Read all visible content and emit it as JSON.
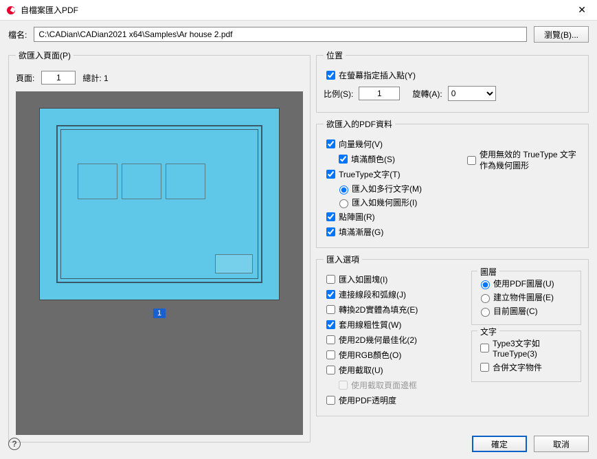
{
  "titlebar": {
    "title": "自檔案匯入PDF"
  },
  "file": {
    "label": "檔名:",
    "path": "C:\\CADian\\CADian2021 x64\\Samples\\Ar house 2.pdf",
    "browse": "瀏覽(B)..."
  },
  "pages": {
    "legend": "欲匯入頁面(P)",
    "page_label": "頁面:",
    "page_value": "1",
    "total_label": "總計: 1",
    "page_badge": "1"
  },
  "position": {
    "legend": "位置",
    "specify": "在螢幕指定插入點(Y)",
    "scale_label": "比例(S):",
    "scale_value": "1",
    "rotate_label": "旋轉(A):",
    "rotate_value": "0"
  },
  "pdfdata": {
    "legend": "欲匯入的PDF資料",
    "vector": "向量幾何(V)",
    "fillcolor": "填滿顏色(S)",
    "truetype": "TrueType文字(T)",
    "import_multiline": "匯入如多行文字(M)",
    "import_geometry": "匯入如幾何圖形(I)",
    "raster": "點陣圖(R)",
    "gradient": "填滿漸層(G)",
    "invalid_tt": "使用無效的 TrueType 文字作為幾何圖形"
  },
  "importopts": {
    "legend": "匯入選項",
    "as_block": "匯入如圖塊(I)",
    "join_lines": "連接線段和弧線(J)",
    "convert_2d": "轉換2D實體為填充(E)",
    "apply_lw": "套用線粗性質(W)",
    "best_2d": "使用2D幾何最佳化(2)",
    "rgb": "使用RGB顏色(O)",
    "clip": "使用截取(U)",
    "clip_bounds": "使用截取頁面邊框",
    "transparency": "使用PDF透明度"
  },
  "layers": {
    "legend": "圖層",
    "use_pdf": "使用PDF圖層(U)",
    "create_obj": "建立物件圖層(E)",
    "current": "目前圖層(C)"
  },
  "text": {
    "legend": "文字",
    "type3": "Type3文字如TrueType(3)",
    "merge": "合併文字物件"
  },
  "footer": {
    "ok": "確定",
    "cancel": "取消"
  }
}
